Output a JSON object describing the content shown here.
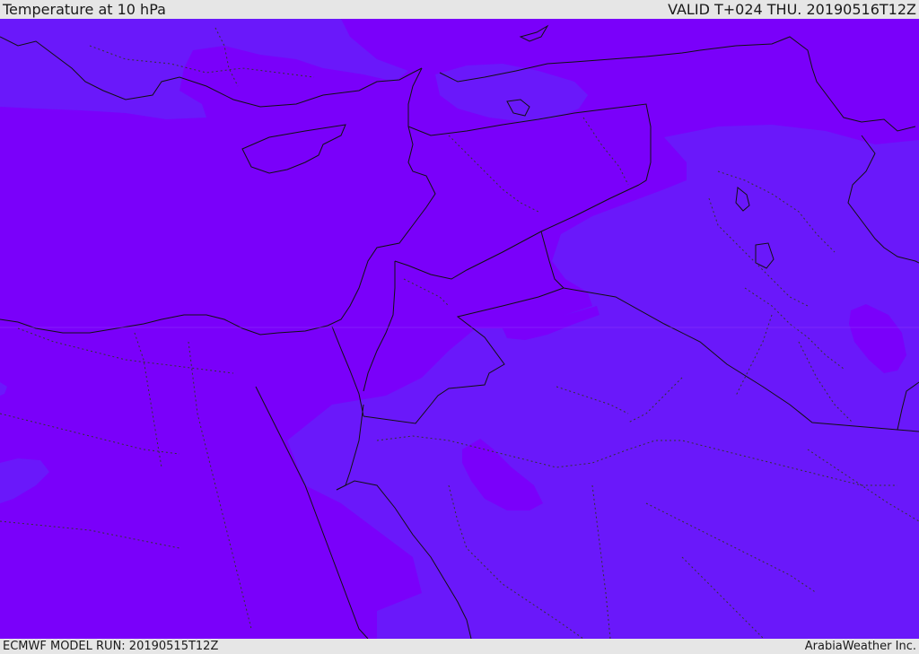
{
  "header": {
    "title": "Temperature at 10 hPa",
    "valid": "VALID T+024 THU. 20190516T12Z"
  },
  "footer": {
    "model_run": "ECMWF MODEL RUN: 20190515T12Z",
    "credit": "ArabiaWeather Inc."
  },
  "legend_colors": {
    "warmer_band": "#7a00fa",
    "cooler_band": "#6a18fa",
    "coast_line": "#111111",
    "border_line": "#111111",
    "province_line": "#333333"
  }
}
